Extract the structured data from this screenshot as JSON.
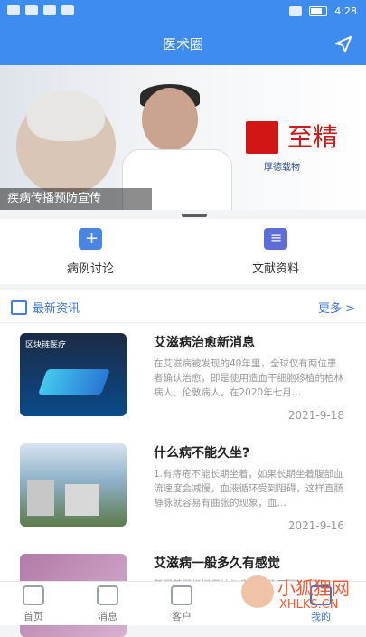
{
  "status": {
    "time": "4:28"
  },
  "app": {
    "title": "医术圈"
  },
  "banner": {
    "caption": "疾病传播预防宣传",
    "brand_text": "至精",
    "brand_sub": "厚德载物"
  },
  "quick": [
    {
      "label": "病例讨论",
      "icon": "case-discussion-icon"
    },
    {
      "label": "文献资料",
      "icon": "document-icon"
    }
  ],
  "news": {
    "title": "最新资讯",
    "more": "更多 >",
    "items": [
      {
        "title": "艾滋病治愈新消息",
        "desc": "在艾滋病被发现的40年里，全球仅有两位患者确认治愈，即是使用造血干细胞移植的柏林病人、伦敦病人。在2020年七月…",
        "date": "2021-9-18",
        "thumb_text": "区块链医疗"
      },
      {
        "title": "什么病不能久坐?",
        "desc": "1.有痔疮不能长期坐着，如果长期坐着腹部血流速度会减慢，血液循环受到阻碍，这样直肠静脉就容易有曲张的现象，血…",
        "date": "2021-9-16"
      },
      {
        "title": "艾滋病一般多久有感觉",
        "desc": "新冠基因根据保护与病毒感染不同，因而…"
      }
    ]
  },
  "tabs": [
    {
      "label": "首页",
      "icon": "home-icon"
    },
    {
      "label": "消息",
      "icon": "message-icon"
    },
    {
      "label": "客户",
      "icon": "customer-icon"
    },
    {
      "label": "我的",
      "icon": "profile-icon"
    }
  ],
  "watermark": {
    "text": "小狐狸网",
    "sub": "XHLKS.CN"
  }
}
